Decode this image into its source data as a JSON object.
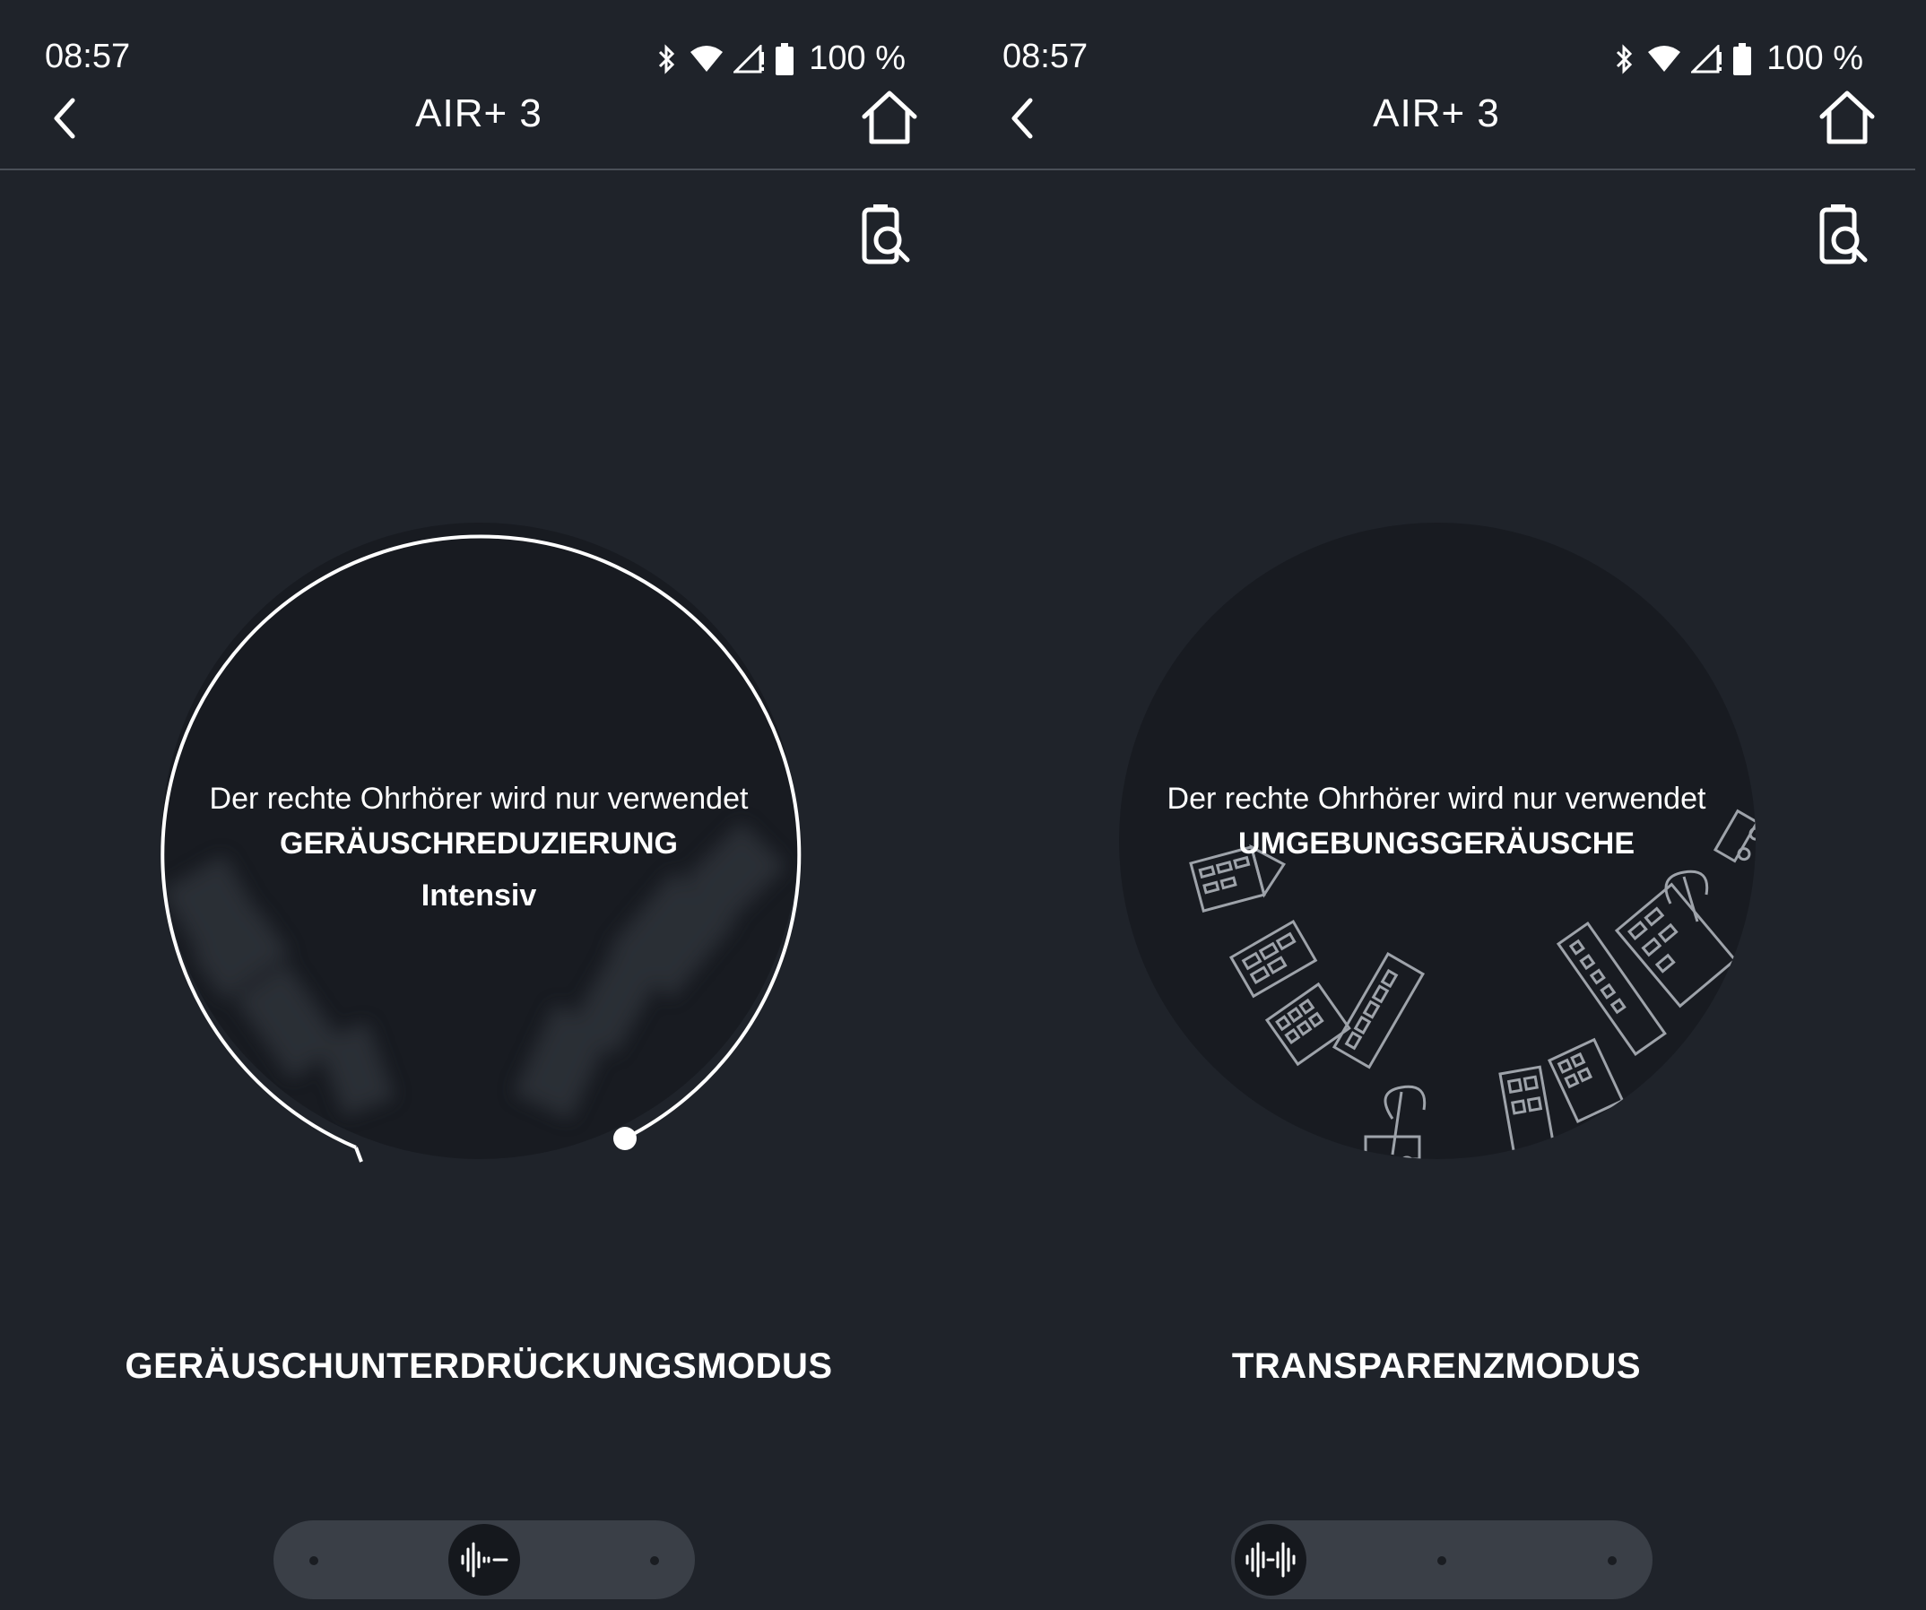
{
  "screens": [
    {
      "status": {
        "time": "08:57",
        "battery": "100 %"
      },
      "header": {
        "title": "AIR+ 3"
      },
      "circle": {
        "used_text": "Der rechte Ohrhörer wird nur verwendet",
        "mode_label": "GERÄUSCHREDUZIERUNG",
        "level_label": "Intensiv"
      },
      "mode_title": "GERÄUSCHUNTERDRÜCKUNGSMODUS",
      "selector": {
        "active_index": 1,
        "options": [
          "noise-cancellation-off-icon",
          "noise-cancellation-icon",
          "transparency-icon"
        ]
      }
    },
    {
      "status": {
        "time": "08:57",
        "battery": "100 %"
      },
      "header": {
        "title": "AIR+ 3"
      },
      "circle": {
        "used_text": "Der rechte Ohrhörer wird nur verwendet",
        "mode_label": "UMGEBUNGSGERÄUSCHE"
      },
      "mode_title": "TRANSPARENZMODUS",
      "selector": {
        "active_index": 0,
        "options": [
          "transparency-icon",
          "noise-cancellation-icon",
          "noise-cancellation-off-icon"
        ]
      }
    }
  ],
  "colors": {
    "background": "#1f232a",
    "circle_fill": "#181b21",
    "selector_track": "#3a3f47",
    "text": "#ffffff"
  }
}
